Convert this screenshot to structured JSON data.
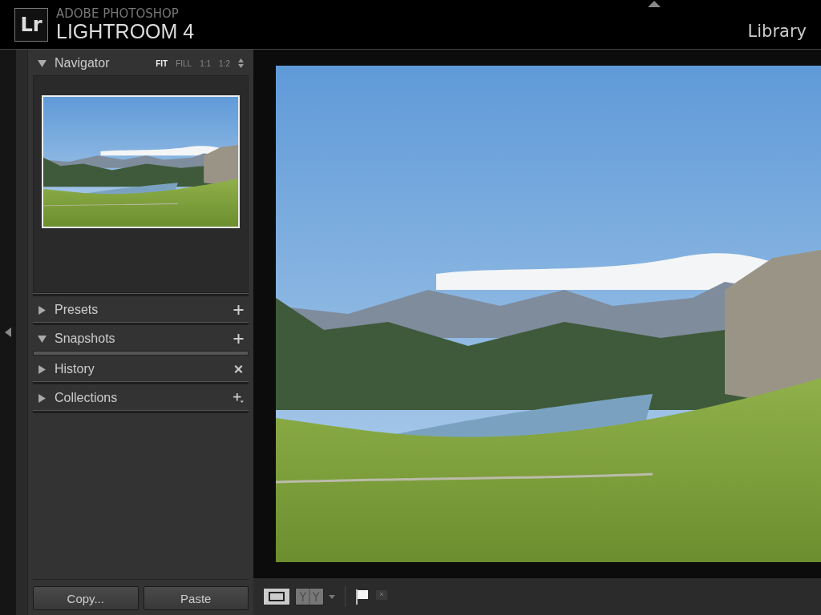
{
  "app": {
    "brand_top": "ADOBE PHOTOSHOP",
    "brand_name": "LIGHTROOM 4",
    "logo": "Lr",
    "module": "Library"
  },
  "navigator": {
    "title": "Navigator",
    "expanded": true,
    "zoom_options": [
      {
        "label": "FIT",
        "selected": true
      },
      {
        "label": "FILL",
        "selected": false
      },
      {
        "label": "1:1",
        "selected": false
      },
      {
        "label": "1:2",
        "selected": false
      }
    ]
  },
  "panels": [
    {
      "title": "Presets",
      "expanded": false,
      "kind": "plus"
    },
    {
      "title": "Snapshots",
      "expanded": true,
      "kind": "plus"
    },
    {
      "title": "History",
      "expanded": false,
      "kind": "clear"
    },
    {
      "title": "Collections",
      "expanded": false,
      "kind": "plus-menu"
    }
  ],
  "buttons": [
    "Copy...",
    "Paste"
  ],
  "toolbar": {
    "loupe_selected": true,
    "compare_selected": false,
    "flag_selected": true
  }
}
